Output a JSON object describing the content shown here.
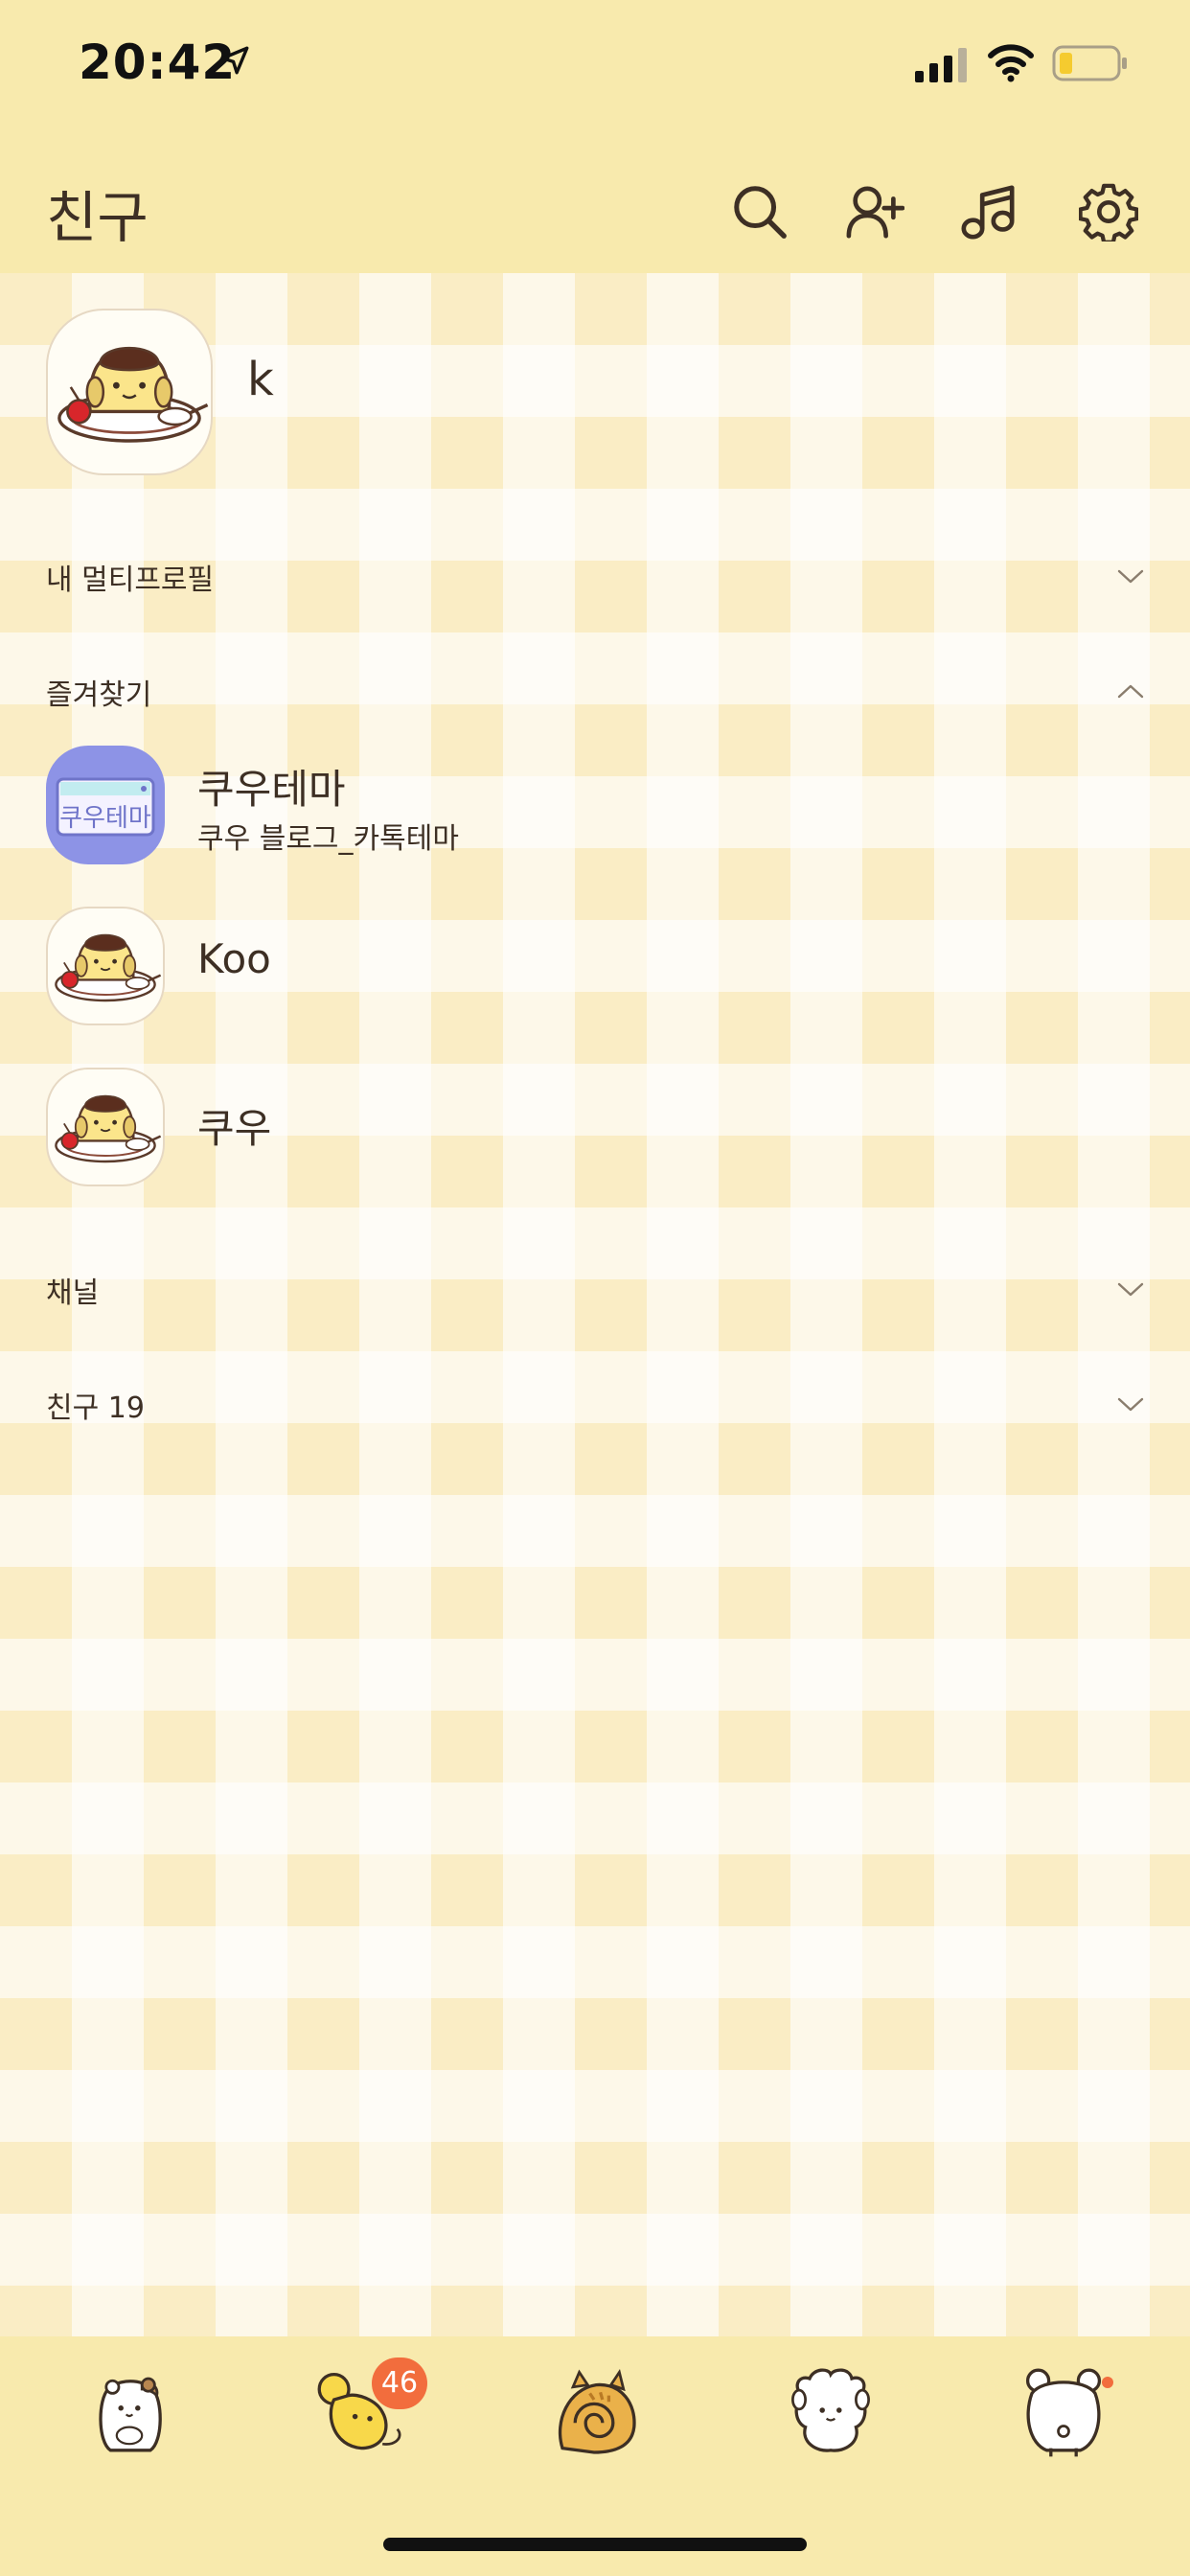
{
  "status_bar": {
    "time": "20:42",
    "icons": [
      "location-arrow-icon",
      "cellular-signal-icon",
      "wifi-icon",
      "battery-low-icon"
    ]
  },
  "header": {
    "title": "친구",
    "actions": [
      "search-icon",
      "add-friend-icon",
      "music-icon",
      "settings-gear-icon"
    ]
  },
  "my_profile": {
    "name": "k",
    "avatar_icon": "pudding-dog-icon"
  },
  "sections": {
    "multi_profile": {
      "label": "내 멀티프로필",
      "state": "collapsed"
    },
    "favorites": {
      "label": "즐겨찾기",
      "state": "expanded"
    },
    "channel": {
      "label": "채널",
      "state": "collapsed"
    },
    "friends": {
      "label": "친구 19",
      "state": "collapsed"
    }
  },
  "favorites": [
    {
      "name": "쿠우테마",
      "status": "쿠우 블로그_카톡테마",
      "avatar_icon": "theme-card-icon",
      "avatar_text": "쿠우테마"
    },
    {
      "name": "Koo",
      "status": "",
      "avatar_icon": "pudding-dog-icon"
    },
    {
      "name": "쿠우",
      "status": "",
      "avatar_icon": "pudding-dog-icon"
    }
  ],
  "tab_bar": {
    "tabs": [
      {
        "name": "friends-tab",
        "icon": "hamster-icon"
      },
      {
        "name": "chats-tab",
        "icon": "mouse-icon",
        "badge": "46"
      },
      {
        "name": "view-tab",
        "icon": "snail-cat-icon"
      },
      {
        "name": "shopping-tab",
        "icon": "sheep-icon"
      },
      {
        "name": "more-tab",
        "icon": "bear-back-icon",
        "dot": true
      }
    ]
  },
  "colors": {
    "header_bg": "#f8eaad",
    "badge": "#f26d3d",
    "text": "#3d2f24",
    "theme_avatar": "#8d93e6"
  }
}
